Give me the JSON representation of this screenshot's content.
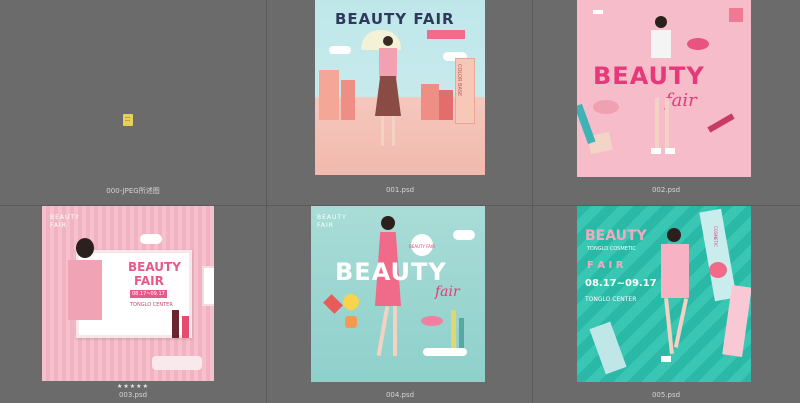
{
  "files": [
    {
      "name": "000-JPEG所述图"
    },
    {
      "name": "001.psd",
      "title": "BEAUTY FAIR",
      "label": "COLOR BASE"
    },
    {
      "name": "002.psd",
      "title": "BEAUTY",
      "script": "fair"
    },
    {
      "name": "003.psd",
      "corner": "BEAUTY FAIR",
      "title1": "BEAUTY",
      "title2": "FAIR",
      "dates": "08.17~09.17",
      "venue": "TONGLO CENTER",
      "rating": "★★★★★"
    },
    {
      "name": "004.psd",
      "corner": "BEAUTY FAIR",
      "title": "BEAUTY",
      "script": "fair",
      "badge": "BEAUTY FAIR"
    },
    {
      "name": "005.psd",
      "title1": "BEAUTY",
      "subtitle": "TONGLO COSMETIC",
      "title2": "F A I R",
      "dates": "08.17~09.17",
      "venue": "TONGLO CENTER",
      "tube": "COSMETIC"
    }
  ],
  "colors": {
    "background": "#6b6b6b",
    "grid": "#5a5a5a",
    "caption": "#d6d6d6",
    "pink": "#f0a5b8",
    "hotpink": "#e5397a",
    "teal": "#2bb9a7",
    "mint": "#9fdad6"
  },
  "icons": {
    "file_0": "file-icon"
  }
}
